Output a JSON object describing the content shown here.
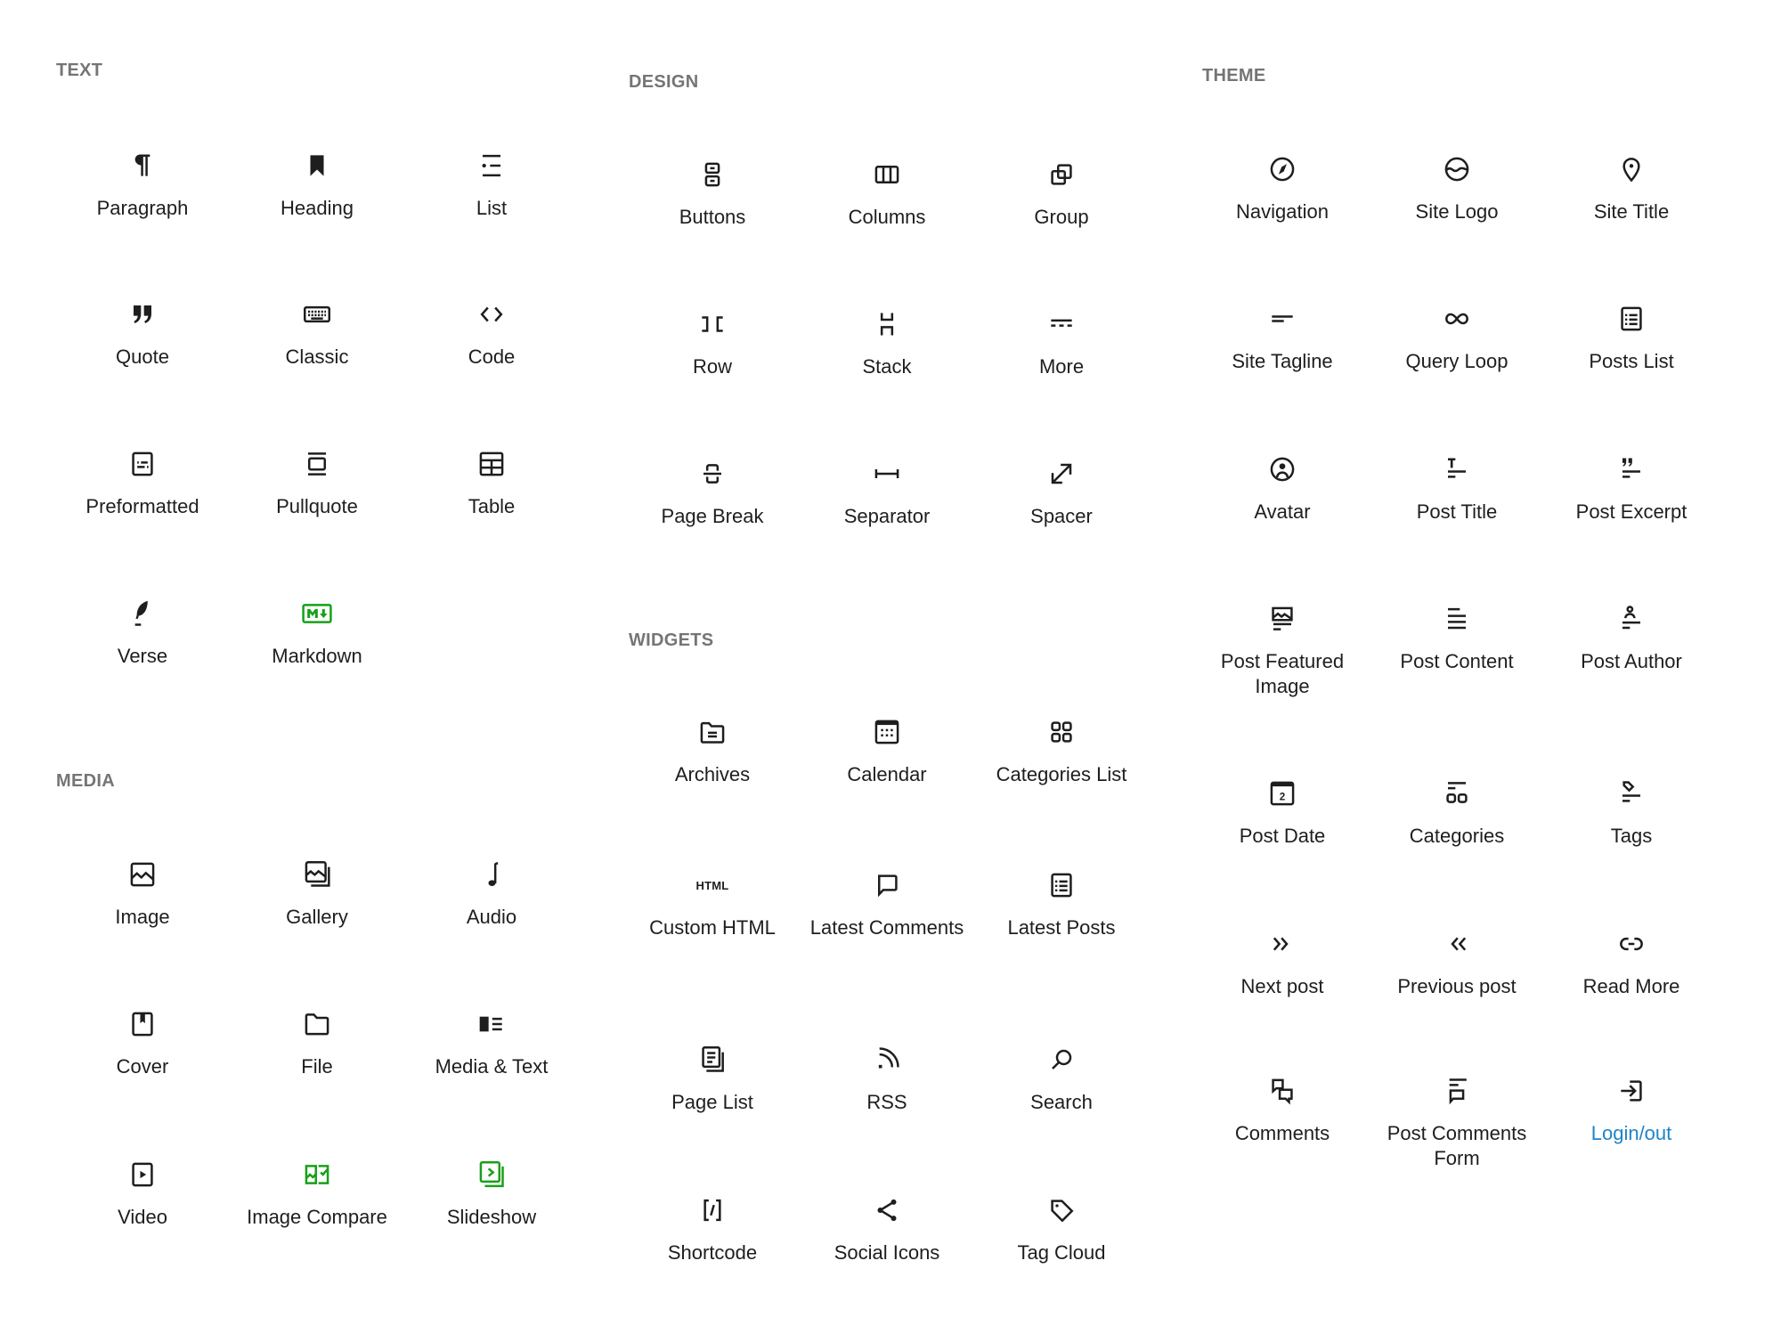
{
  "colors": {
    "text": "#1e1e1e",
    "section": "#757575",
    "accent_green": "#18a018",
    "link_blue": "#1e85c7"
  },
  "sections": {
    "text": {
      "title": "TEXT",
      "items": [
        {
          "label": "Paragraph",
          "icon": "paragraph-icon"
        },
        {
          "label": "Heading",
          "icon": "heading-bookmark-icon"
        },
        {
          "label": "List",
          "icon": "list-icon"
        },
        {
          "label": "Quote",
          "icon": "quote-icon"
        },
        {
          "label": "Classic",
          "icon": "keyboard-icon"
        },
        {
          "label": "Code",
          "icon": "code-icon"
        },
        {
          "label": "Preformatted",
          "icon": "preformatted-icon"
        },
        {
          "label": "Pullquote",
          "icon": "pullquote-icon"
        },
        {
          "label": "Table",
          "icon": "table-icon"
        },
        {
          "label": "Verse",
          "icon": "feather-icon"
        },
        {
          "label": "Markdown",
          "icon": "markdown-icon"
        }
      ]
    },
    "media": {
      "title": "MEDIA",
      "items": [
        {
          "label": "Image",
          "icon": "image-icon"
        },
        {
          "label": "Gallery",
          "icon": "gallery-icon"
        },
        {
          "label": "Audio",
          "icon": "music-note-icon"
        },
        {
          "label": "Cover",
          "icon": "cover-icon"
        },
        {
          "label": "File",
          "icon": "folder-icon"
        },
        {
          "label": "Media & Text",
          "icon": "media-text-icon"
        },
        {
          "label": "Video",
          "icon": "video-icon"
        },
        {
          "label": "Image Compare",
          "icon": "image-compare-icon"
        },
        {
          "label": "Slideshow",
          "icon": "slideshow-icon"
        }
      ]
    },
    "design": {
      "title": "DESIGN",
      "items": [
        {
          "label": "Buttons",
          "icon": "buttons-icon"
        },
        {
          "label": "Columns",
          "icon": "columns-icon"
        },
        {
          "label": "Group",
          "icon": "group-icon"
        },
        {
          "label": "Row",
          "icon": "row-icon"
        },
        {
          "label": "Stack",
          "icon": "stack-icon"
        },
        {
          "label": "More",
          "icon": "more-icon"
        },
        {
          "label": "Page Break",
          "icon": "page-break-icon"
        },
        {
          "label": "Separator",
          "icon": "separator-icon"
        },
        {
          "label": "Spacer",
          "icon": "spacer-icon"
        }
      ]
    },
    "widgets": {
      "title": "WIDGETS",
      "items": [
        {
          "label": "Archives",
          "icon": "archive-icon"
        },
        {
          "label": "Calendar",
          "icon": "calendar-icon"
        },
        {
          "label": "Categories List",
          "icon": "categories-grid-icon"
        },
        {
          "label": "Custom HTML",
          "icon": "html-icon",
          "glyph": "HTML"
        },
        {
          "label": "Latest Comments",
          "icon": "comment-icon"
        },
        {
          "label": "Latest Posts",
          "icon": "post-list-icon"
        },
        {
          "label": "Page List",
          "icon": "pages-icon"
        },
        {
          "label": "RSS",
          "icon": "rss-icon"
        },
        {
          "label": "Search",
          "icon": "search-icon"
        },
        {
          "label": "Shortcode",
          "icon": "shortcode-icon"
        },
        {
          "label": "Social Icons",
          "icon": "share-icon"
        },
        {
          "label": "Tag Cloud",
          "icon": "tag-icon"
        }
      ]
    },
    "theme": {
      "title": "THEME",
      "items": [
        {
          "label": "Navigation",
          "icon": "compass-icon"
        },
        {
          "label": "Site Logo",
          "icon": "site-logo-icon"
        },
        {
          "label": "Site Title",
          "icon": "map-marker-icon"
        },
        {
          "label": "Site Tagline",
          "icon": "tagline-icon"
        },
        {
          "label": "Query Loop",
          "icon": "loop-icon"
        },
        {
          "label": "Posts List",
          "icon": "post-list-icon"
        },
        {
          "label": "Avatar",
          "icon": "avatar-icon"
        },
        {
          "label": "Post Title",
          "icon": "post-title-icon"
        },
        {
          "label": "Post Excerpt",
          "icon": "post-excerpt-icon"
        },
        {
          "label": "Post Featured Image",
          "icon": "post-featured-image-icon"
        },
        {
          "label": "Post Content",
          "icon": "post-content-icon"
        },
        {
          "label": "Post Author",
          "icon": "post-author-icon"
        },
        {
          "label": "Post Date",
          "icon": "post-date-icon",
          "glyph": "2"
        },
        {
          "label": "Categories",
          "icon": "post-categories-icon"
        },
        {
          "label": "Tags",
          "icon": "post-terms-icon"
        },
        {
          "label": "Next post",
          "icon": "next-icon"
        },
        {
          "label": "Previous post",
          "icon": "previous-icon"
        },
        {
          "label": "Read More",
          "icon": "link-icon"
        },
        {
          "label": "Comments",
          "icon": "comments-icon"
        },
        {
          "label": "Post Comments Form",
          "icon": "post-comments-form-icon"
        },
        {
          "label": "Login/out",
          "icon": "login-icon",
          "is_link": true
        }
      ]
    }
  }
}
